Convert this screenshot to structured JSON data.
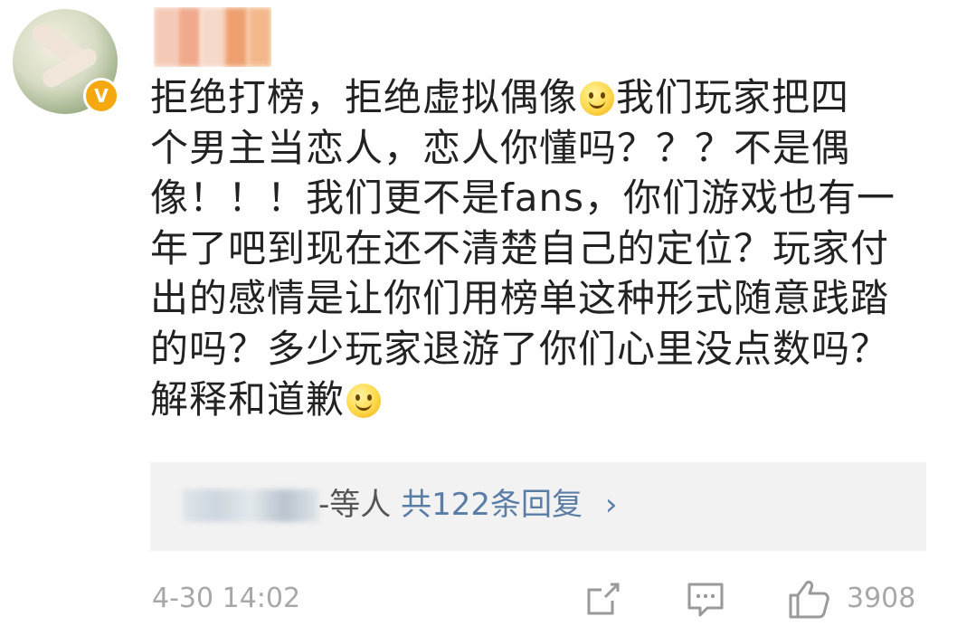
{
  "comment": {
    "lines": [
      "拒绝打榜，拒绝虚拟偶像",
      "我们玩家把四",
      "个男主当恋人，恋人你懂吗？？？不是偶",
      "像！！！我们更不是fans，你们游戏也有一",
      "年了吧到现在还不清楚自己的定位？玩家付",
      "出的感情是让你们用榜单这种形式随意践踏",
      "的吗？多少玩家退游了你们心里没点数吗？",
      "解释和道歉"
    ]
  },
  "badge": {
    "label": "V"
  },
  "replies": {
    "suffix": "-等人",
    "count_label": "共122条回复",
    "chevron": "›"
  },
  "footer": {
    "timestamp": "4-30 14:02",
    "like_count": "3908"
  },
  "icons": [
    "share-icon",
    "comment-icon",
    "like-icon",
    "smile-emoji-icon",
    "verified-badge-icon"
  ],
  "colors": {
    "accent": "#5a7da6",
    "badge": "#f6a80f",
    "text": "#222222",
    "muted": "#a8a8a8"
  }
}
